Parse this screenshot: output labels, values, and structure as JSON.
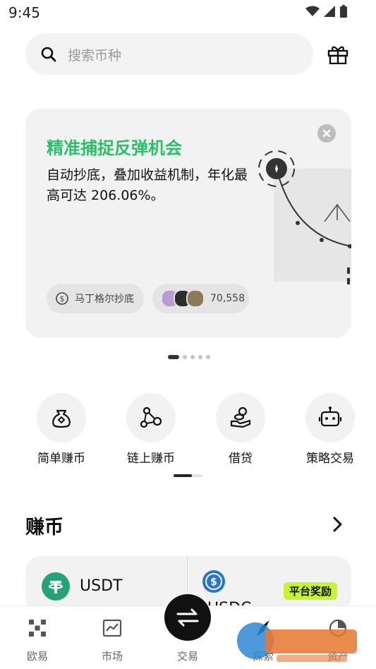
{
  "status_bar": {
    "time": "9:45"
  },
  "search": {
    "placeholder": "搜索币种"
  },
  "banner": {
    "title": "精准捕捉反弹机会",
    "description": "自动抄底，叠加收益机制，年化最高可达 206.06%。",
    "strategy_pill": "马丁格尔抄底",
    "participants_count": "70,558",
    "page_total": 5,
    "page_active": 1
  },
  "features": [
    {
      "label": "简单赚币",
      "icon": "money-bag-icon"
    },
    {
      "label": "链上赚币",
      "icon": "chain-nodes-icon"
    },
    {
      "label": "借贷",
      "icon": "coins-hand-icon"
    },
    {
      "label": "策略交易",
      "icon": "robot-icon"
    }
  ],
  "earn_section": {
    "title": "赚币",
    "cards": [
      {
        "symbol": "USDT",
        "icon": "tether-icon",
        "icon_color": "#26a17b"
      },
      {
        "symbol": "USDC",
        "icon": "usdc-icon",
        "icon_color": "#2775ca",
        "badge": "平台奖励"
      }
    ]
  },
  "tab_bar": {
    "tabs": [
      {
        "label": "欧易",
        "icon": "okx-logo-icon"
      },
      {
        "label": "市场",
        "icon": "chart-icon"
      },
      {
        "label": "交易",
        "icon": "swap-icon"
      },
      {
        "label": "探索",
        "icon": "compass-icon"
      },
      {
        "label": "资产",
        "icon": "pie-chart-icon"
      }
    ]
  },
  "colors": {
    "accent_green": "#2bbf6a",
    "reward_badge": "#c6f432"
  }
}
